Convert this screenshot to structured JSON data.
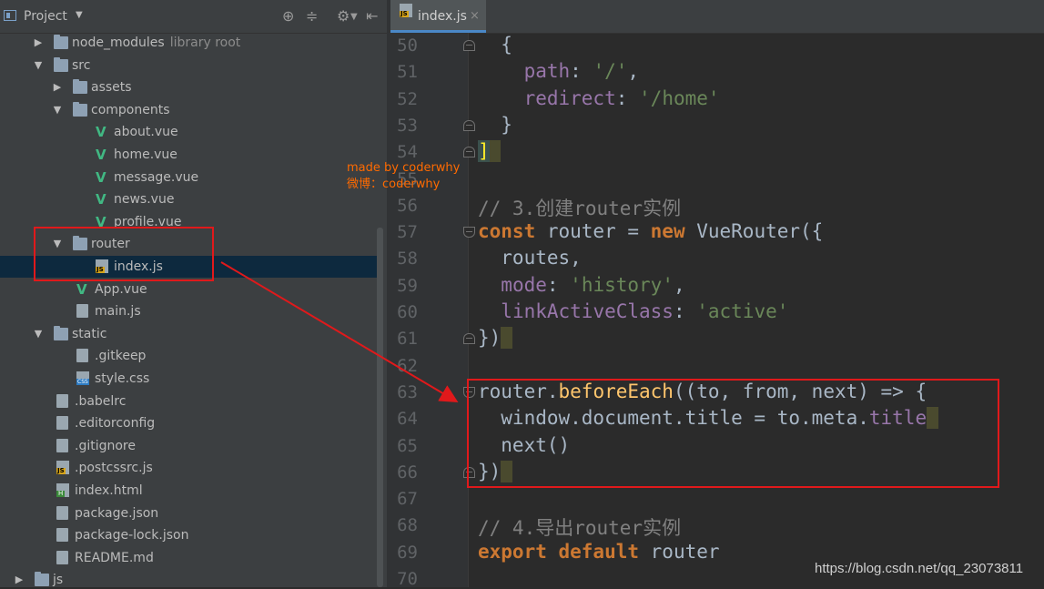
{
  "project_panel": {
    "title": "Project",
    "tree": [
      {
        "label": "node_modules",
        "sub": "library root",
        "kind": "folder",
        "depth": 1,
        "expanded": false
      },
      {
        "label": "src",
        "kind": "folder",
        "depth": 1,
        "expanded": true
      },
      {
        "label": "assets",
        "kind": "folder",
        "depth": 2,
        "expanded": false
      },
      {
        "label": "components",
        "kind": "folder",
        "depth": 2,
        "expanded": true
      },
      {
        "label": "about.vue",
        "kind": "vue",
        "depth": 3
      },
      {
        "label": "home.vue",
        "kind": "vue",
        "depth": 3
      },
      {
        "label": "message.vue",
        "kind": "vue",
        "depth": 3
      },
      {
        "label": "news.vue",
        "kind": "vue",
        "depth": 3
      },
      {
        "label": "profile.vue",
        "kind": "vue",
        "depth": 3
      },
      {
        "label": "router",
        "kind": "folder",
        "depth": 2,
        "expanded": true
      },
      {
        "label": "index.js",
        "kind": "js",
        "depth": 3,
        "selected": true
      },
      {
        "label": "App.vue",
        "kind": "vue",
        "depth": 2
      },
      {
        "label": "main.js",
        "kind": "file",
        "depth": 2
      },
      {
        "label": "static",
        "kind": "folder",
        "depth": 1,
        "expanded": true
      },
      {
        "label": ".gitkeep",
        "kind": "file",
        "depth": 2
      },
      {
        "label": "style.css",
        "kind": "css",
        "depth": 2
      },
      {
        "label": ".babelrc",
        "kind": "file",
        "depth": 1
      },
      {
        "label": ".editorconfig",
        "kind": "file",
        "depth": 1
      },
      {
        "label": ".gitignore",
        "kind": "file",
        "depth": 1
      },
      {
        "label": ".postcssrc.js",
        "kind": "js",
        "depth": 1
      },
      {
        "label": "index.html",
        "kind": "html",
        "depth": 1
      },
      {
        "label": "package.json",
        "kind": "file",
        "depth": 1
      },
      {
        "label": "package-lock.json",
        "kind": "file",
        "depth": 1
      },
      {
        "label": "README.md",
        "kind": "file",
        "depth": 1
      },
      {
        "label": "js",
        "kind": "folder",
        "depth": 0,
        "expanded": false
      }
    ]
  },
  "editor": {
    "tab_label": "index.js",
    "tab_close": "×",
    "lines": [
      {
        "n": "50",
        "tokens": [
          [
            "p",
            "  {"
          ]
        ]
      },
      {
        "n": "51",
        "tokens": [
          [
            "p",
            "    "
          ],
          [
            "prop",
            "path"
          ],
          [
            "p",
            ": "
          ],
          [
            "str",
            "'/'"
          ],
          [
            "p",
            ","
          ]
        ]
      },
      {
        "n": "52",
        "tokens": [
          [
            "p",
            "    "
          ],
          [
            "prop",
            "redirect"
          ],
          [
            "p",
            ": "
          ],
          [
            "str",
            "'/home'"
          ]
        ]
      },
      {
        "n": "53",
        "tokens": [
          [
            "p",
            "  }"
          ]
        ]
      },
      {
        "n": "54",
        "tokens": [
          [
            "bkt",
            "]"
          ]
        ]
      },
      {
        "n": "55",
        "tokens": []
      },
      {
        "n": "56",
        "tokens": [
          [
            "cmt",
            "// 3.创建router实例"
          ]
        ]
      },
      {
        "n": "57",
        "tokens": [
          [
            "kw",
            "const"
          ],
          [
            "p",
            " router = "
          ],
          [
            "kw",
            "new"
          ],
          [
            "p",
            " VueRouter({"
          ]
        ]
      },
      {
        "n": "58",
        "tokens": [
          [
            "p",
            "  routes,"
          ]
        ]
      },
      {
        "n": "59",
        "tokens": [
          [
            "p",
            "  "
          ],
          [
            "prop",
            "mode"
          ],
          [
            "p",
            ": "
          ],
          [
            "str",
            "'history'"
          ],
          [
            "p",
            ","
          ]
        ]
      },
      {
        "n": "60",
        "tokens": [
          [
            "p",
            "  "
          ],
          [
            "prop",
            "linkActiveClass"
          ],
          [
            "p",
            ": "
          ],
          [
            "str",
            "'active'"
          ]
        ]
      },
      {
        "n": "61",
        "tokens": [
          [
            "p",
            "})"
          ]
        ]
      },
      {
        "n": "62",
        "tokens": []
      },
      {
        "n": "63",
        "tokens": [
          [
            "p",
            "router."
          ],
          [
            "fn",
            "beforeEach"
          ],
          [
            "p",
            "((to, from, next) => {"
          ]
        ]
      },
      {
        "n": "64",
        "tokens": [
          [
            "p",
            "  window.document.title = to.meta."
          ],
          [
            "prop",
            "title"
          ]
        ]
      },
      {
        "n": "65",
        "tokens": [
          [
            "p",
            "  next()"
          ]
        ]
      },
      {
        "n": "66",
        "tokens": [
          [
            "p",
            "})"
          ]
        ]
      },
      {
        "n": "67",
        "tokens": []
      },
      {
        "n": "68",
        "tokens": [
          [
            "cmt",
            "// 4.导出router实例"
          ]
        ]
      },
      {
        "n": "69",
        "tokens": [
          [
            "kw",
            "export default"
          ],
          [
            "p",
            " router"
          ]
        ]
      },
      {
        "n": "70",
        "tokens": []
      }
    ]
  },
  "watermark": {
    "line1": "made by coderwhy",
    "line2": "微博：coderwhy"
  },
  "url_credit": "https://blog.csdn.net/qq_23073811",
  "colors": {
    "annotation_red": "#e0191b",
    "keyword": "#cc7832",
    "string": "#6a8759",
    "property": "#9876aa",
    "function": "#ffc66d",
    "comment": "#808080",
    "watermark": "#ff6a00"
  }
}
